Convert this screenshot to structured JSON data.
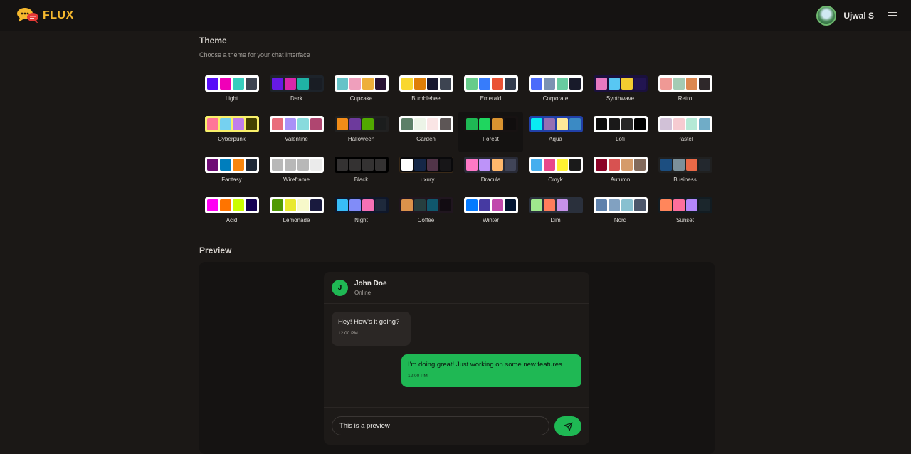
{
  "app": {
    "brand": "FLUX"
  },
  "user": {
    "name": "Ujwal S"
  },
  "theme_section": {
    "title": "Theme",
    "subtitle": "Choose a theme for your chat interface",
    "themes": [
      {
        "name": "Light",
        "frame": "",
        "colors": [
          "#570df8",
          "#f000b8",
          "#37cdbe",
          "#3d4451"
        ]
      },
      {
        "name": "Dark",
        "frame": "dark-frame",
        "colors": [
          "#661ae6",
          "#d926aa",
          "#1fb2a5",
          "#191d24"
        ]
      },
      {
        "name": "Cupcake",
        "frame": "",
        "colors": [
          "#65c3c8",
          "#ef9fbc",
          "#eeaf3a",
          "#291334"
        ]
      },
      {
        "name": "Bumblebee",
        "frame": "",
        "colors": [
          "#f9d72f",
          "#df7e07",
          "#181830",
          "#3d4451"
        ]
      },
      {
        "name": "Emerald",
        "frame": "",
        "colors": [
          "#66cc8a",
          "#377cfb",
          "#ea5234",
          "#333c4d"
        ]
      },
      {
        "name": "Corporate",
        "frame": "",
        "colors": [
          "#4b6bfb",
          "#7b92b2",
          "#67cba0",
          "#181a2a"
        ]
      },
      {
        "name": "Synthwave",
        "frame": "synth-frame",
        "colors": [
          "#e779c1",
          "#58c7f3",
          "#f3cc30",
          "#221551"
        ]
      },
      {
        "name": "Retro",
        "frame": "",
        "colors": [
          "#ef9995",
          "#a4cbb4",
          "#dc8850",
          "#2e282a"
        ]
      },
      {
        "name": "Cyberpunk",
        "frame": "yellow-frame",
        "colors": [
          "#ff7598",
          "#75d1f0",
          "#c07eec",
          "#423f00"
        ]
      },
      {
        "name": "Valentine",
        "frame": "",
        "colors": [
          "#e96d7b",
          "#a991f7",
          "#88dbdd",
          "#af4670"
        ]
      },
      {
        "name": "Halloween",
        "frame": "halloween-frame",
        "colors": [
          "#f28c18",
          "#6d3a9c",
          "#51a800",
          "#1b1d1d"
        ]
      },
      {
        "name": "Garden",
        "frame": "",
        "colors": [
          "#5c7f67",
          "#ecf4e7",
          "#fae5e5",
          "#5d5656"
        ]
      },
      {
        "name": "Forest",
        "frame": "forest-frame",
        "colors": [
          "#1eb854",
          "#1fd65f",
          "#d99330",
          "#110e0e"
        ]
      },
      {
        "name": "Aqua",
        "frame": "blue-frame",
        "colors": [
          "#09ecf3",
          "#966fb3",
          "#ffe999",
          "#3b8ac4"
        ]
      },
      {
        "name": "Lofi",
        "frame": "",
        "colors": [
          "#0d0d0d",
          "#1a1919",
          "#262626",
          "#000000"
        ]
      },
      {
        "name": "Pastel",
        "frame": "",
        "colors": [
          "#d1c1d7",
          "#f6cbd1",
          "#b4e9d6",
          "#70acc7"
        ]
      },
      {
        "name": "Fantasy",
        "frame": "",
        "colors": [
          "#6e0b75",
          "#007ebd",
          "#f8860d",
          "#1f2937"
        ]
      },
      {
        "name": "Wireframe",
        "frame": "",
        "colors": [
          "#b8b8b8",
          "#b8b8b8",
          "#b8b8b8",
          "#ebebeb"
        ]
      },
      {
        "name": "Black",
        "frame": "black-frame",
        "colors": [
          "#343232",
          "#343232",
          "#343232",
          "#343232"
        ]
      },
      {
        "name": "Luxury",
        "frame": "luxury-frame",
        "colors": [
          "#ffffff",
          "#152747",
          "#513448",
          "#171618"
        ]
      },
      {
        "name": "Dracula",
        "frame": "dracula-frame",
        "colors": [
          "#ff79c6",
          "#bd93f9",
          "#ffb86c",
          "#414558"
        ]
      },
      {
        "name": "Cmyk",
        "frame": "",
        "colors": [
          "#45aeee",
          "#e8488a",
          "#fff232",
          "#1a1a1a"
        ]
      },
      {
        "name": "Autumn",
        "frame": "",
        "colors": [
          "#8c0327",
          "#d85251",
          "#d59b6a",
          "#826a5c"
        ]
      },
      {
        "name": "Business",
        "frame": "business-frame",
        "colors": [
          "#1c4e80",
          "#7c909a",
          "#ea6947",
          "#23282e"
        ]
      },
      {
        "name": "Acid",
        "frame": "",
        "colors": [
          "#ff00f4",
          "#ff7400",
          "#cbfd03",
          "#140152"
        ]
      },
      {
        "name": "Lemonade",
        "frame": "",
        "colors": [
          "#519903",
          "#e9e92e",
          "#f7f9ca",
          "#191a3e"
        ]
      },
      {
        "name": "Night",
        "frame": "night-frame",
        "colors": [
          "#38bdf8",
          "#818cf8",
          "#f471b5",
          "#1e293b"
        ]
      },
      {
        "name": "Coffee",
        "frame": "coffee-frame",
        "colors": [
          "#db924b",
          "#263e3f",
          "#10576d",
          "#120c12"
        ]
      },
      {
        "name": "Winter",
        "frame": "",
        "colors": [
          "#047aff",
          "#463aa2",
          "#c148ac",
          "#021431"
        ]
      },
      {
        "name": "Dim",
        "frame": "dim-frame",
        "colors": [
          "#9fe88d",
          "#ff7d5c",
          "#c792e9",
          "#2a303c"
        ]
      },
      {
        "name": "Nord",
        "frame": "",
        "colors": [
          "#5e81ac",
          "#81a1c1",
          "#88c0d0",
          "#4c566a"
        ]
      },
      {
        "name": "Sunset",
        "frame": "sunset-frame",
        "colors": [
          "#ff865b",
          "#fd6f9c",
          "#b387fa",
          "#1b262c"
        ]
      }
    ]
  },
  "preview": {
    "title": "Preview",
    "contact": {
      "initial": "J",
      "name": "John Doe",
      "status": "Online"
    },
    "messages": {
      "incoming": {
        "text": "Hey! How's it going?",
        "time": "12:00 PM"
      },
      "outgoing": {
        "text": "I'm doing great! Just working on some new features.",
        "time": "12:00 PM"
      }
    },
    "input_value": "This is a preview"
  }
}
